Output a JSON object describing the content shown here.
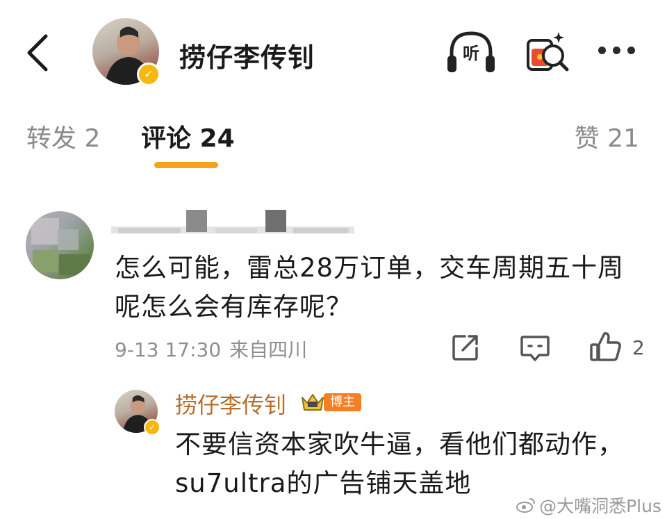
{
  "header": {
    "user_name": "捞仔李传钊",
    "listen_label": "听"
  },
  "tabs": {
    "repost": "转发 2",
    "comment": "评论 24",
    "like": "赞 21"
  },
  "comment": {
    "text": "怎么可能，雷总28万订单，交车周期五十周呢怎么会有库存呢？",
    "time": "9-13 17:30",
    "location": "来自四川",
    "like_count": "2"
  },
  "reply": {
    "author": "捞仔李传钊",
    "badge": "博主",
    "text": "不要信资本家吹牛逼，看他们都动作，su7ultra的广告铺天盖地"
  },
  "watermark": {
    "text": "@大嘴洞悉Plus"
  },
  "colors": {
    "accent_underline": "#f7a21b",
    "author_name": "#b76c2a",
    "author_badge": "#f57f25",
    "verified": "#f6b80c"
  }
}
